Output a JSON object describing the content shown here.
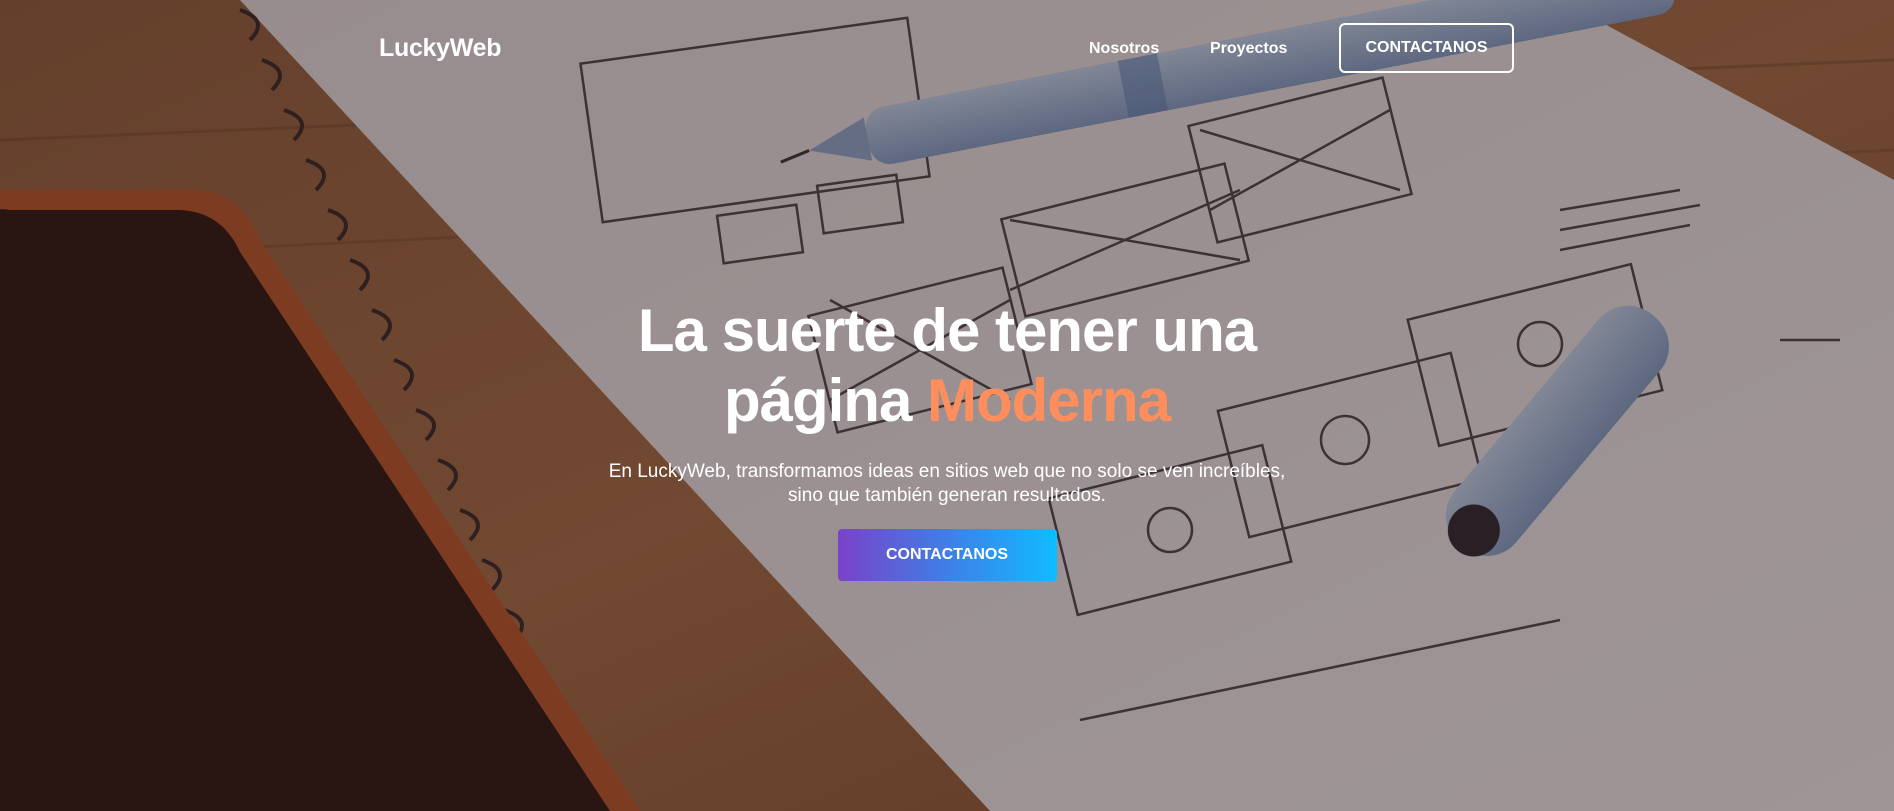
{
  "nav": {
    "logo": "LuckyWeb",
    "links": [
      "Nosotros",
      "Proyectos"
    ],
    "cta_label": "CONTACTANOS"
  },
  "hero": {
    "title_line1": "La suerte de tener una",
    "title_line2_prefix": "página ",
    "title_accent": "Moderna",
    "subtitle": "En LuckyWeb, transformamos ideas en sitios web que no solo se ven increíbles, sino que también generan resultados.",
    "cta_label": "CONTACTANOS"
  },
  "colors": {
    "accent": "#ff8e5c",
    "cta_gradient_start": "#7a42c8",
    "cta_gradient_end": "#0fbcff",
    "text": "#ffffff"
  }
}
